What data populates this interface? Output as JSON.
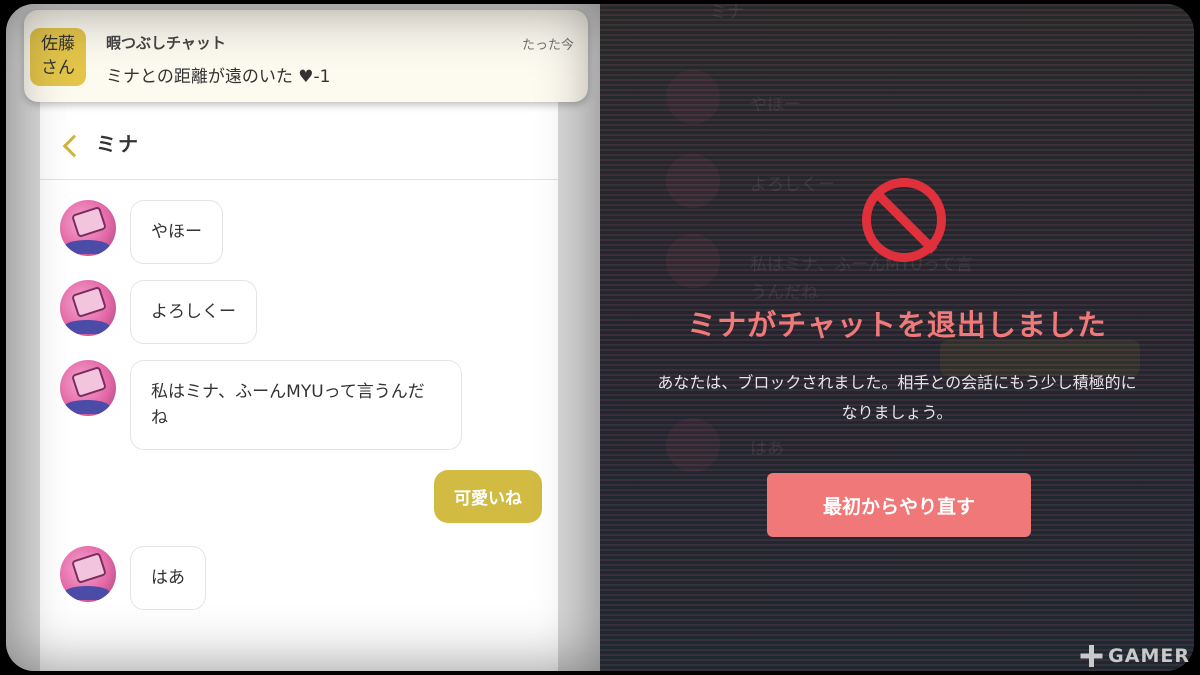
{
  "notification": {
    "avatar_name": "佐藤",
    "avatar_suffix": "さん",
    "app_name": "暇つぶしチャット",
    "time": "たった今",
    "message": "ミナとの距離が遠のいた ♥-1"
  },
  "chat": {
    "title": "ミナ",
    "messages": [
      {
        "text": "やほー"
      },
      {
        "text": "よろしくー"
      },
      {
        "text": "私はミナ、ふーんMYUって言うんだね"
      },
      {
        "text": "可愛いね"
      },
      {
        "text": "はあ"
      }
    ]
  },
  "overlay": {
    "title": "ミナがチャットを退出しました",
    "description": "あなたは、ブロックされました。相手との会話にもう少し積極的になりましょう。",
    "restart_label": "最初からやり直す"
  },
  "background_ghost": {
    "lines": [
      "やほー",
      "よろしくー",
      "私はミナ、ふーんMYUって言",
      "うんだね",
      "はあ",
      "ミナ"
    ]
  },
  "watermark": {
    "text": "GAMER"
  },
  "colors": {
    "accent_yellow": "#d2bb42",
    "alert_red": "#e0303c",
    "button_pink": "#f07878"
  }
}
